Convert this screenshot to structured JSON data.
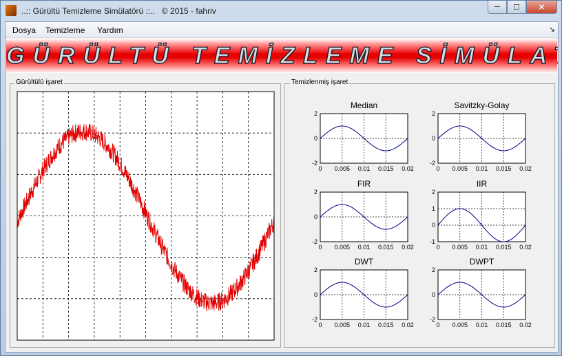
{
  "window": {
    "title": "..:: Gürültü Temizleme Simülatörü ::..   © 2015 - fahriv",
    "minimize_label": "─",
    "maximize_label": "☐",
    "close_label": "✕"
  },
  "menu": {
    "items": [
      "Dosya",
      "Temizleme",
      "Yardım"
    ],
    "overflow_arrow": "↘"
  },
  "banner": {
    "text": "GÜRÜLTÜ TEMİZLEME SİMÜLATÖRÜ"
  },
  "noisy_panel": {
    "title": "Gürültülü işaret"
  },
  "clean_panel": {
    "title": "Temizlenmiş işaret"
  },
  "colors": {
    "noisy_signal": "#e00000",
    "clean_signal": "#00008b",
    "banner_red": "#e60000"
  },
  "chart_data": [
    {
      "type": "line",
      "title": "",
      "series": [
        {
          "description": "noisy sine wave",
          "values_x_range": [
            0,
            0.02
          ],
          "amplitude": 1,
          "noise": "high-frequency random"
        }
      ],
      "x": {
        "ticks_visible": false
      },
      "y": {
        "ticks_visible": false
      },
      "grid": true
    },
    {
      "type": "line",
      "title": "Median",
      "xlim": [
        0,
        0.02
      ],
      "ylim": [
        -2,
        2
      ],
      "xticks": [
        "0",
        "0.005",
        "0.01",
        "0.015",
        "0.02"
      ],
      "yticks": [
        "-2",
        "0",
        "2"
      ],
      "grid": true,
      "series": [
        {
          "x": [
            0,
            0.0025,
            0.005,
            0.0075,
            0.01,
            0.0125,
            0.015,
            0.0175,
            0.02
          ],
          "y": [
            0,
            0.71,
            1,
            0.71,
            0,
            -0.71,
            -1,
            -0.71,
            0
          ]
        }
      ]
    },
    {
      "type": "line",
      "title": "Savitzky-Golay",
      "xlim": [
        0,
        0.02
      ],
      "ylim": [
        -2,
        2
      ],
      "xticks": [
        "0",
        "0.005",
        "0.01",
        "0.015",
        "0.02"
      ],
      "yticks": [
        "-2",
        "0",
        "2"
      ],
      "grid": true,
      "series": [
        {
          "x": [
            0,
            0.0025,
            0.005,
            0.0075,
            0.01,
            0.0125,
            0.015,
            0.0175,
            0.02
          ],
          "y": [
            0,
            0.71,
            1,
            0.71,
            0,
            -0.71,
            -1,
            -0.71,
            0
          ]
        }
      ]
    },
    {
      "type": "line",
      "title": "FIR",
      "xlim": [
        0,
        0.02
      ],
      "ylim": [
        -2,
        2
      ],
      "xticks": [
        "0",
        "0.005",
        "0.01",
        "0.015",
        "0.02"
      ],
      "yticks": [
        "-2",
        "0",
        "2"
      ],
      "grid": true,
      "series": [
        {
          "x": [
            0,
            0.0025,
            0.005,
            0.0075,
            0.01,
            0.0125,
            0.015,
            0.0175,
            0.02
          ],
          "y": [
            0,
            0.71,
            1,
            0.71,
            0,
            -0.71,
            -1,
            -0.71,
            0
          ]
        }
      ]
    },
    {
      "type": "line",
      "title": "IIR",
      "xlim": [
        0,
        0.02
      ],
      "ylim": [
        -1,
        2
      ],
      "xticks": [
        "0",
        "0.005",
        "0.01",
        "0.015",
        "0.02"
      ],
      "yticks": [
        "-1",
        "0",
        "1",
        "2"
      ],
      "grid": true,
      "series": [
        {
          "x": [
            0,
            0.0025,
            0.005,
            0.0075,
            0.01,
            0.0125,
            0.015,
            0.0175,
            0.02
          ],
          "y": [
            0,
            0.71,
            1,
            0.71,
            0,
            -0.71,
            -1,
            -0.71,
            0
          ]
        }
      ]
    },
    {
      "type": "line",
      "title": "DWT",
      "xlim": [
        0,
        0.02
      ],
      "ylim": [
        -2,
        2
      ],
      "xticks": [
        "0",
        "0.005",
        "0.01",
        "0.015",
        "0.02"
      ],
      "yticks": [
        "-2",
        "0",
        "2"
      ],
      "grid": true,
      "series": [
        {
          "x": [
            0,
            0.0025,
            0.005,
            0.0075,
            0.01,
            0.0125,
            0.015,
            0.0175,
            0.02
          ],
          "y": [
            0,
            0.71,
            1,
            0.71,
            0,
            -0.71,
            -1,
            -0.71,
            0
          ]
        }
      ]
    },
    {
      "type": "line",
      "title": "DWPT",
      "xlim": [
        0,
        0.02
      ],
      "ylim": [
        -2,
        2
      ],
      "xticks": [
        "0",
        "0.005",
        "0.01",
        "0.015",
        "0.02"
      ],
      "yticks": [
        "-2",
        "0",
        "2"
      ],
      "grid": true,
      "series": [
        {
          "x": [
            0,
            0.0025,
            0.005,
            0.0075,
            0.01,
            0.0125,
            0.015,
            0.0175,
            0.02
          ],
          "y": [
            0,
            0.71,
            1,
            0.71,
            0,
            -0.71,
            -1,
            -0.71,
            0
          ]
        }
      ]
    }
  ]
}
